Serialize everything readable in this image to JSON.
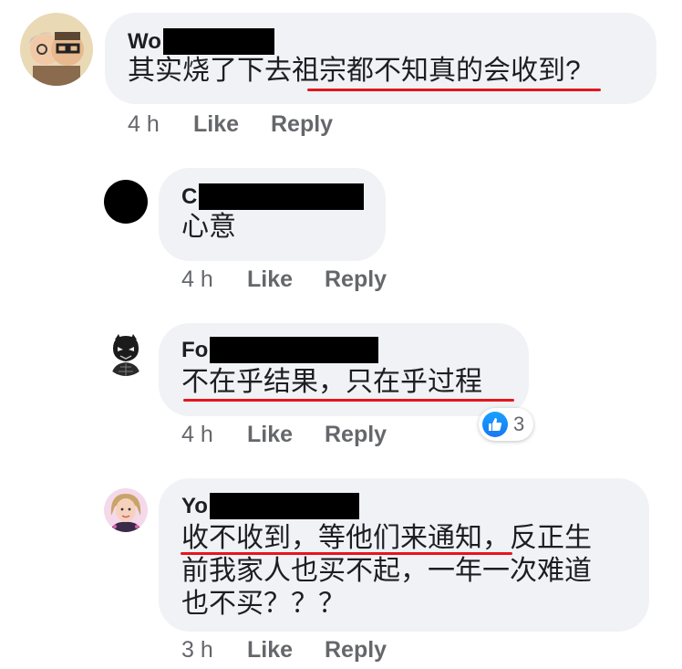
{
  "comments": [
    {
      "name_visible": "Wo",
      "text_lines": [
        "其实烧了下去祖宗都不知真的会收到?"
      ],
      "time": "4 h",
      "like_label": "Like",
      "reply_label": "Reply"
    },
    {
      "name_visible": "C",
      "text_lines": [
        "心意"
      ],
      "time": "4 h",
      "like_label": "Like",
      "reply_label": "Reply"
    },
    {
      "name_visible": "Fo",
      "text_lines": [
        "不在乎结果，只在乎过程"
      ],
      "time": "4 h",
      "like_label": "Like",
      "reply_label": "Reply",
      "reaction": {
        "icon": "like-icon",
        "count": "3"
      }
    },
    {
      "name_visible": "Yo",
      "text_lines": [
        "收不收到，等他们来通知，反正生",
        "前我家人也买不起，一年一次难道",
        "也不买？？？"
      ],
      "time": "3 h",
      "like_label": "Like",
      "reply_label": "Reply"
    }
  ],
  "colors": {
    "bubble": "#f0f2f5",
    "underline": "#e4161d",
    "meta": "#65676b",
    "like_blue": "#1877f2"
  }
}
